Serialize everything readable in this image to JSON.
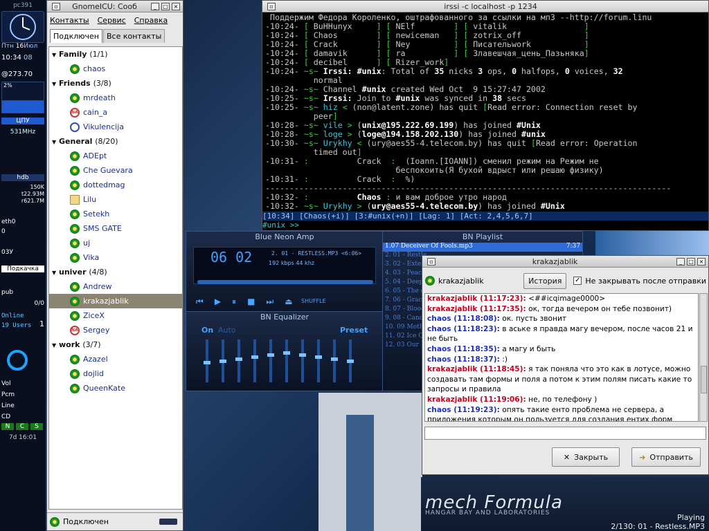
{
  "desktop": {
    "logo": "mech Formula",
    "logo_sub": "HANGAR BAY AND LABORATORIES",
    "playing_label": "Playing",
    "playing_track": "2/130: 01 - Restless.MP3"
  },
  "dock": {
    "host": "pc391",
    "day": "Птн",
    "date": "16",
    "month": "Июл",
    "time": "10:34",
    "sec": "08",
    "beat": "@273.70",
    "cpu_pct": "2%",
    "cpu_label": "ЦПУ",
    "cpu_freq": "531MHz",
    "disk": "hdb",
    "disk_a": "150K",
    "disk_b": "t22.93M",
    "disk_c": "r621.7M",
    "net": "eth0",
    "net_val": "0",
    "mem": "03У",
    "connect_label": "Подкачка",
    "pub": "pub",
    "mail_count": "0/0",
    "online": "Online",
    "users": "19 Users",
    "vol": "Vol",
    "pcm": "Pcm",
    "line": "Line",
    "cd": "CD",
    "ncs": [
      "N",
      "C",
      "S"
    ],
    "uptime": "7d 16:01",
    "online_count": "1"
  },
  "icu": {
    "title": "GnomeICU: Сооб",
    "menu": [
      "Контакты",
      "Сервис",
      "Справка"
    ],
    "tabs": [
      "Подключен",
      "Все контакты"
    ],
    "status": "Подключен",
    "groups": [
      {
        "name": "Family",
        "count": "(1/1)",
        "contacts": [
          {
            "n": "chaos",
            "i": "flower"
          }
        ]
      },
      {
        "name": "Friends",
        "count": "(3/8)",
        "contacts": [
          {
            "n": "mrdeath",
            "i": "flower"
          },
          {
            "n": "cain_a",
            "i": "na"
          },
          {
            "n": "Vikulencija",
            "i": "user"
          }
        ]
      },
      {
        "name": "General",
        "count": "(8/20)",
        "contacts": [
          {
            "n": "ADEpt",
            "i": "flower"
          },
          {
            "n": "Che Guevara",
            "i": "flower"
          },
          {
            "n": "dottedmag",
            "i": "flower"
          },
          {
            "n": "Lilu",
            "i": "mail"
          },
          {
            "n": "Setekh",
            "i": "flower"
          },
          {
            "n": "SMS GATE",
            "i": "flower"
          },
          {
            "n": "uj",
            "i": "flower"
          },
          {
            "n": "Vika",
            "i": "flower"
          }
        ]
      },
      {
        "name": "univer",
        "count": "(4/8)",
        "contacts": [
          {
            "n": "Andrew",
            "i": "flower"
          },
          {
            "n": "krakazjablik",
            "i": "flower",
            "sel": true
          },
          {
            "n": "ZiceX",
            "i": "flower"
          },
          {
            "n": "Sergey",
            "i": "na"
          }
        ]
      },
      {
        "name": "work",
        "count": "(3/7)",
        "contacts": [
          {
            "n": "Azazel",
            "i": "flower"
          },
          {
            "n": "dojlid",
            "i": "flower"
          },
          {
            "n": "QueenKate",
            "i": "flower"
          }
        ]
      }
    ]
  },
  "irssi": {
    "title": "irssi -c localhost -p 1234",
    "status": "[10:34] [Chaos(+i)] [3:#unix(+n)] [Lag: 1] [Act: 2,4,5,6,7]",
    "prompt": "#unix >>"
  },
  "amp": {
    "title": "Blue Neon Amp",
    "time": "06 02",
    "track": "2. 01 - RESTLESS.MP3 <6:06>",
    "kbps": "192",
    "khz": "44",
    "shuffle": "SHUFFLE"
  },
  "eq": {
    "title": "BN Equalizer",
    "on": "On",
    "auto": "Auto",
    "preset": "Preset",
    "levels": [
      0.55,
      0.5,
      0.45,
      0.4,
      0.35,
      0.3,
      0.35,
      0.4,
      0.45,
      0.5
    ]
  },
  "playlist": {
    "title": "BN Playlist",
    "current": "1.07 Deceiver Of Fools.mp3",
    "current_len": "7:37",
    "items": [
      "2. 01 - Restle",
      "3. 02 - Exter",
      "4. 03 - Peach",
      "5. 04 - Deepe",
      "6. 05 - The ex",
      "7. 06 - Graci",
      "8. 07 - Blood",
      "9. 08 - Candl",
      "10. 09 Mothe",
      "11. 02 Ice Qu",
      "12. 03 Our R"
    ]
  },
  "chat": {
    "title": "krakazjablik",
    "nick": "krakazjablik",
    "history": "История",
    "keep_open": "Не закрывать после отправки",
    "close": "Закрыть",
    "send": "Отправить",
    "messages": [
      {
        "who": "krakazjablik (11:17:23):",
        "text": "<##icqimage0000>",
        "me": true
      },
      {
        "who": "krakazjablik (11:17:35):",
        "text": "ок, тогда вечером он тебе позвонит)",
        "me": true
      },
      {
        "who": "chaos (11:18:08):",
        "text": "ок. пусть звонит",
        "me": false
      },
      {
        "who": "chaos (11:18:23):",
        "text": "в аське я правда магу вечером, после часов 21 и не быть",
        "me": false
      },
      {
        "who": "chaos (11:18:35):",
        "text": "а магу и быть",
        "me": false
      },
      {
        "who": "chaos (11:18:37):",
        "text": ":)",
        "me": false
      },
      {
        "who": "krakazjablik (11:18:45):",
        "text": "я так поняла что это как в лотусе, можно создавать там формы и поля а потом к этим полям писать какие то запросы и правила",
        "me": true
      },
      {
        "who": "krakazjablik (11:19:06):",
        "text": "не, по телефону )",
        "me": true
      },
      {
        "who": "chaos (11:19:23):",
        "text": "опять такие енто проблема не сервера, а приложения которым он пользуется для создания ентих форм",
        "me": false
      }
    ]
  }
}
